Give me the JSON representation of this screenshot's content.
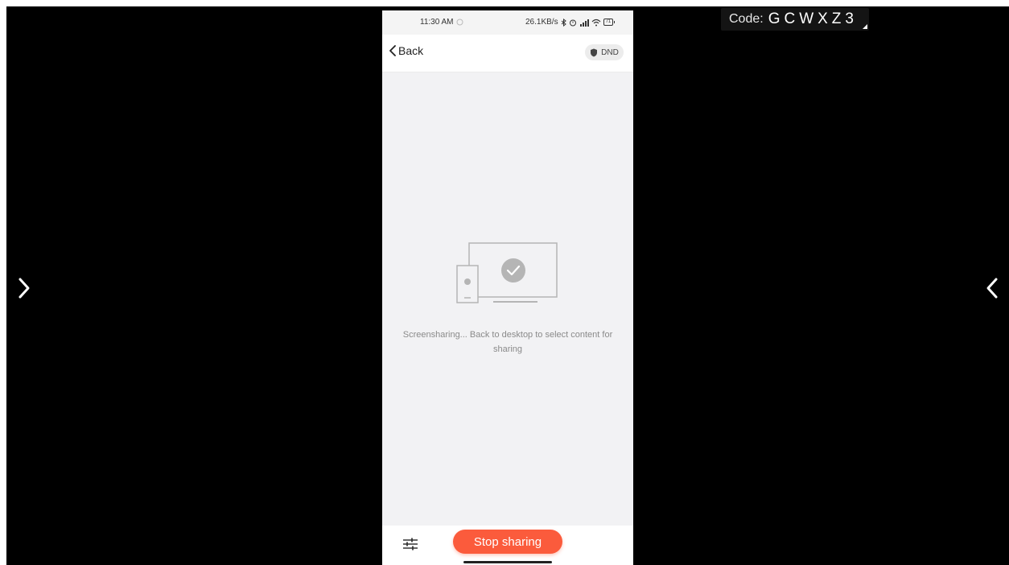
{
  "overlay": {
    "code_label": "Code:",
    "code_value": "GCWXZ3"
  },
  "status_bar": {
    "time": "11:30 AM",
    "network_speed": "26.1KB/s",
    "battery": "71"
  },
  "header": {
    "back_label": "Back",
    "dnd_label": "DND"
  },
  "content": {
    "message": "Screensharing... Back to desktop to select content for sharing"
  },
  "bottom_bar": {
    "stop_label": "Stop sharing"
  },
  "colors": {
    "accent": "#fb5b3c",
    "background": "#000000",
    "phone_bg": "#f2f2f4"
  },
  "icons": [
    "chevron-right-icon",
    "chevron-left-icon",
    "back-chevron-icon",
    "shield-icon",
    "screen-share-icon",
    "settings-sliders-icon"
  ]
}
